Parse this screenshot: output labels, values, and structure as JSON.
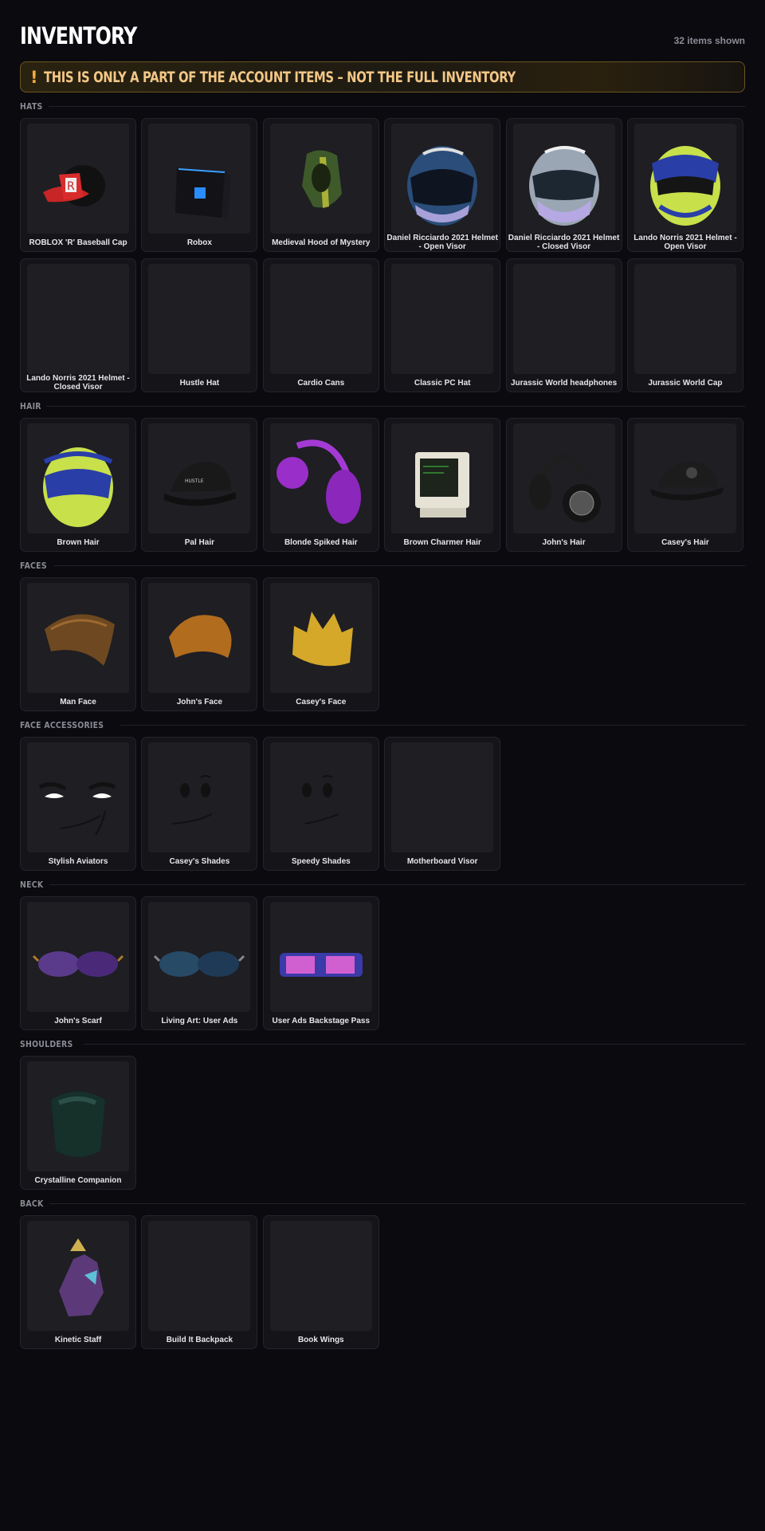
{
  "header": {
    "title": "INVENTORY",
    "count": "32 items shown"
  },
  "warning": {
    "icon": "!",
    "text": "THIS IS ONLY A PART OF THE ACCOUNT ITEMS – NOT THE FULL INVENTORY"
  },
  "sections": [
    {
      "label": "HATS",
      "items": [
        {
          "name": "ROBLOX 'R' Baseball Cap",
          "icon": "baseball-cap-icon"
        },
        {
          "name": "Robox",
          "icon": "robox-icon"
        },
        {
          "name": "Medieval Hood of Mystery",
          "icon": "hood-icon"
        },
        {
          "name": "Daniel Ricciardo 2021 Helmet - Open Visor",
          "icon": "helmet-icon"
        },
        {
          "name": "Daniel Ricciardo 2021 Helmet - Closed Visor",
          "icon": "helmet-icon"
        },
        {
          "name": "Lando Norris 2021 Helmet - Open Visor",
          "icon": "helmet-icon"
        },
        {
          "name": "Lando Norris 2021 Helmet - Closed Visor",
          "icon": "helmet-icon"
        },
        {
          "name": "Hustle Hat",
          "icon": "cap-icon"
        },
        {
          "name": "Cardio Cans",
          "icon": "earmuffs-icon"
        },
        {
          "name": "Classic PC Hat",
          "icon": "computer-icon"
        },
        {
          "name": "Jurassic World headphones",
          "icon": "headphones-icon"
        },
        {
          "name": "Jurassic World Cap",
          "icon": "cap-icon"
        }
      ]
    },
    {
      "label": "HAIR",
      "items": [
        {
          "name": "Brown Hair",
          "icon": "hair-icon"
        },
        {
          "name": "Pal Hair",
          "icon": "hair-icon"
        },
        {
          "name": "Blonde Spiked Hair",
          "icon": "hair-icon"
        },
        {
          "name": "Brown Charmer Hair",
          "icon": "hair-icon"
        },
        {
          "name": "John's Hair",
          "icon": "hair-icon"
        },
        {
          "name": "Casey's Hair",
          "icon": "hair-icon"
        }
      ]
    },
    {
      "label": "FACES",
      "items": [
        {
          "name": "Man Face",
          "icon": "face-icon"
        },
        {
          "name": "John's Face",
          "icon": "face-icon"
        },
        {
          "name": "Casey's Face",
          "icon": "face-icon"
        }
      ]
    },
    {
      "label": "FACE ACCESSORIES",
      "items": [
        {
          "name": "Stylish Aviators",
          "icon": "sunglasses-icon"
        },
        {
          "name": "Casey's Shades",
          "icon": "sunglasses-icon"
        },
        {
          "name": "Speedy Shades",
          "icon": "sunglasses-icon"
        },
        {
          "name": "Motherboard Visor",
          "icon": "visor-icon"
        }
      ]
    },
    {
      "label": "NECK",
      "items": [
        {
          "name": "John's Scarf",
          "icon": "scarf-icon"
        },
        {
          "name": "Living Art: User Ads",
          "icon": "picture-frame-icon"
        },
        {
          "name": "User Ads Backstage Pass",
          "icon": "lanyard-icon"
        }
      ]
    },
    {
      "label": "SHOULDERS",
      "items": [
        {
          "name": "Crystalline Companion",
          "icon": "companion-icon"
        }
      ]
    },
    {
      "label": "BACK",
      "items": [
        {
          "name": "Kinetic Staff",
          "icon": "staff-icon"
        },
        {
          "name": "Build It Backpack",
          "icon": "backpack-icon"
        },
        {
          "name": "Book Wings",
          "icon": "wings-icon"
        }
      ]
    }
  ],
  "colors": {
    "background": "#0a0a0f",
    "card": "#141419",
    "thumb": "#1e1e23",
    "warning_text": "#f3c786",
    "warning_border": "#6b5420"
  }
}
